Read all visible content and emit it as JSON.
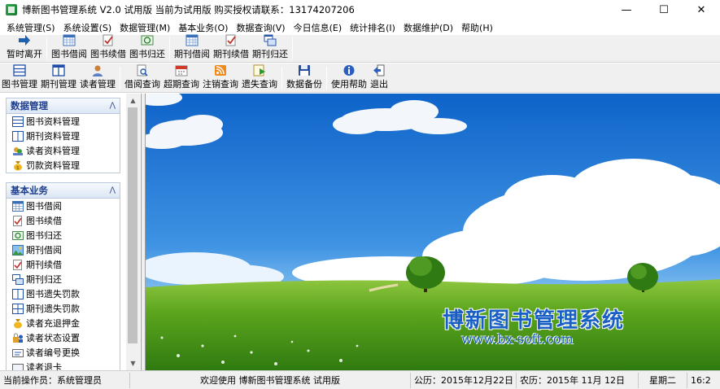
{
  "window": {
    "title": "博新图书管理系统 V2.0  试用版   当前为试用版   购买授权请联系：13174207206",
    "minimize": "—",
    "maximize": "☐",
    "close": "✕"
  },
  "menubar": [
    "系统管理(S)",
    "系统设置(S)",
    "数据管理(M)",
    "基本业务(O)",
    "数据查询(V)",
    "今日信息(E)",
    "统计排名(I)",
    "数据维护(D)",
    "帮助(H)"
  ],
  "toolbar1": {
    "leave": "暂时离开",
    "book_borrow": "图书借阅",
    "book_renew": "图书续借",
    "book_return": "图书归还",
    "journal_borrow": "期刊借阅",
    "journal_renew": "期刊续借",
    "journal_return": "期刊归还"
  },
  "toolbar2": {
    "book_mgmt": "图书管理",
    "journal_mgmt": "期刊管理",
    "reader_mgmt": "读者管理",
    "borrow_query": "借阅查询",
    "overdue_query": "超期查询",
    "cancel_query": "注销查询",
    "lost_query": "遗失查询",
    "backup": "数据备份",
    "help": "使用帮助",
    "exit": "退出"
  },
  "sidebar": {
    "data_panel": {
      "title": "数据管理",
      "items": [
        "图书资料管理",
        "期刊资料管理",
        "读者资料管理",
        "罚款资料管理"
      ]
    },
    "business_panel": {
      "title": "基本业务",
      "items": [
        "图书借阅",
        "图书续借",
        "图书归还",
        "期刊借阅",
        "期刊续借",
        "期刊归还",
        "图书遗失罚款",
        "期刊遗失罚款",
        "读者充退押金",
        "读者状态设置",
        "读者编号更换",
        "读者退卡"
      ]
    }
  },
  "scene": {
    "brand_title": "博新图书管理系统",
    "brand_url": "www.bx-soft.com"
  },
  "statusbar": {
    "operator": "当前操作员：系统管理员",
    "welcome": "欢迎使用  博新图书管理系统  试用版",
    "gregorian": "公历：2015年12月22日",
    "lunar": "农历：2015年 11月 12日",
    "weekday": "星期二",
    "time": "16:2"
  },
  "colors": {
    "brand_blue": "#1a5fc4",
    "panel_title": "#1f3e8c"
  }
}
